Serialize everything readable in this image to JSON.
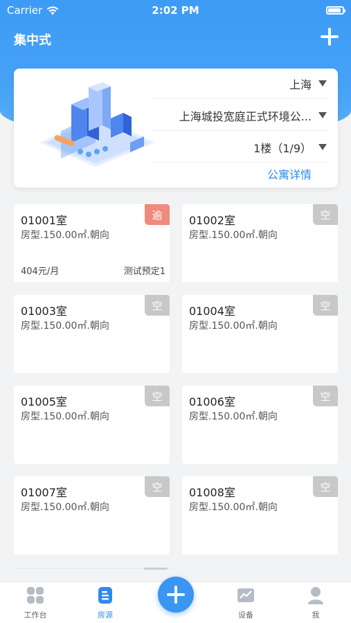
{
  "status_bar": {
    "carrier": "Carrier",
    "time": "2:02 PM",
    "battery_level": 0.9
  },
  "nav": {
    "title": "集中式"
  },
  "building": {
    "city": "上海",
    "project": "上海城投宽庭正式环境公...",
    "floor": "1楼（1/9）",
    "detail_link": "公寓详情"
  },
  "colors": {
    "accent": "#2f8af0",
    "header_blue": "#3d9bf5",
    "overdue": "#f08a7a",
    "vacant": "#c8c8c8"
  },
  "rooms": [
    {
      "no": "01001室",
      "type": "房型.150.00㎡.朝向",
      "badge": "逾",
      "badge_kind": "overdue",
      "price": "404元/月",
      "tenant": "测试预定1"
    },
    {
      "no": "01002室",
      "type": "房型.150.00㎡.朝向",
      "badge": "空",
      "badge_kind": "vacant",
      "price": "",
      "tenant": ""
    },
    {
      "no": "01003室",
      "type": "房型.150.00㎡.朝向",
      "badge": "空",
      "badge_kind": "vacant",
      "price": "",
      "tenant": ""
    },
    {
      "no": "01004室",
      "type": "房型.150.00㎡.朝向",
      "badge": "空",
      "badge_kind": "vacant",
      "price": "",
      "tenant": ""
    },
    {
      "no": "01005室",
      "type": "房型.150.00㎡.朝向",
      "badge": "空",
      "badge_kind": "vacant",
      "price": "",
      "tenant": ""
    },
    {
      "no": "01006室",
      "type": "房型.150.00㎡.朝向",
      "badge": "空",
      "badge_kind": "vacant",
      "price": "",
      "tenant": ""
    },
    {
      "no": "01007室",
      "type": "房型.150.00㎡.朝向",
      "badge": "空",
      "badge_kind": "vacant",
      "price": "",
      "tenant": ""
    },
    {
      "no": "01008室",
      "type": "房型.150.00㎡.朝向",
      "badge": "空",
      "badge_kind": "vacant",
      "price": "",
      "tenant": ""
    }
  ],
  "tabbar": {
    "items": [
      {
        "label": "工作台",
        "icon": "grid-icon"
      },
      {
        "label": "房源",
        "icon": "document-icon"
      },
      {
        "label": "设备",
        "icon": "chart-icon"
      },
      {
        "label": "我",
        "icon": "user-icon"
      }
    ],
    "center_icon": "plus-icon"
  }
}
